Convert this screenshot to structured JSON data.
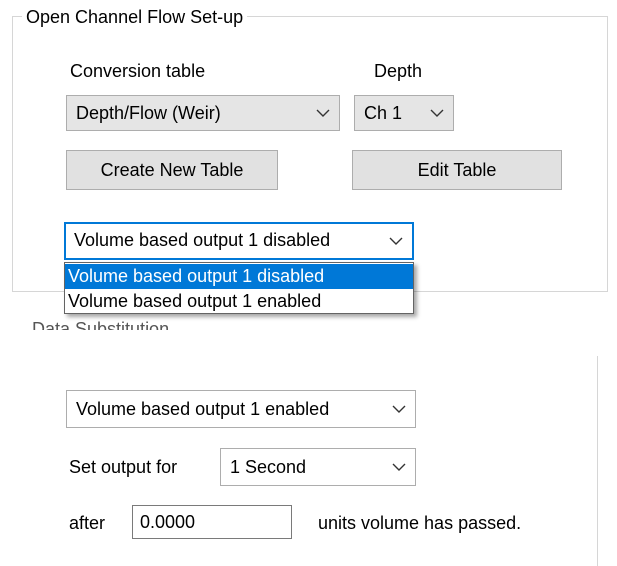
{
  "group": {
    "title": "Open Channel Flow Set-up",
    "conversion_label": "Conversion table",
    "depth_label": "Depth",
    "conversion_value": "Depth/Flow (Weir)",
    "depth_value": "Ch 1",
    "create_button": "Create New Table",
    "edit_button": "Edit Table",
    "volume_select_value": "Volume based output 1 disabled"
  },
  "dropdown": {
    "options": [
      "Volume based output 1 disabled",
      "Volume based output 1 enabled"
    ],
    "selected_index": 0
  },
  "partial_label": "Data Substitution",
  "lower": {
    "volume_select_value": "Volume based output 1 enabled",
    "set_output_label": "Set output for",
    "set_output_value": "1 Second",
    "after_label": "after",
    "after_value": "0.0000",
    "units_label": "units volume has passed."
  },
  "icons": {
    "dropdown_arrow": "chevron-down-icon"
  },
  "colors": {
    "accent": "#0078d7",
    "button_bg": "#e1e1e1",
    "combo_bg": "#e5e5e5",
    "border": "#adadad"
  }
}
